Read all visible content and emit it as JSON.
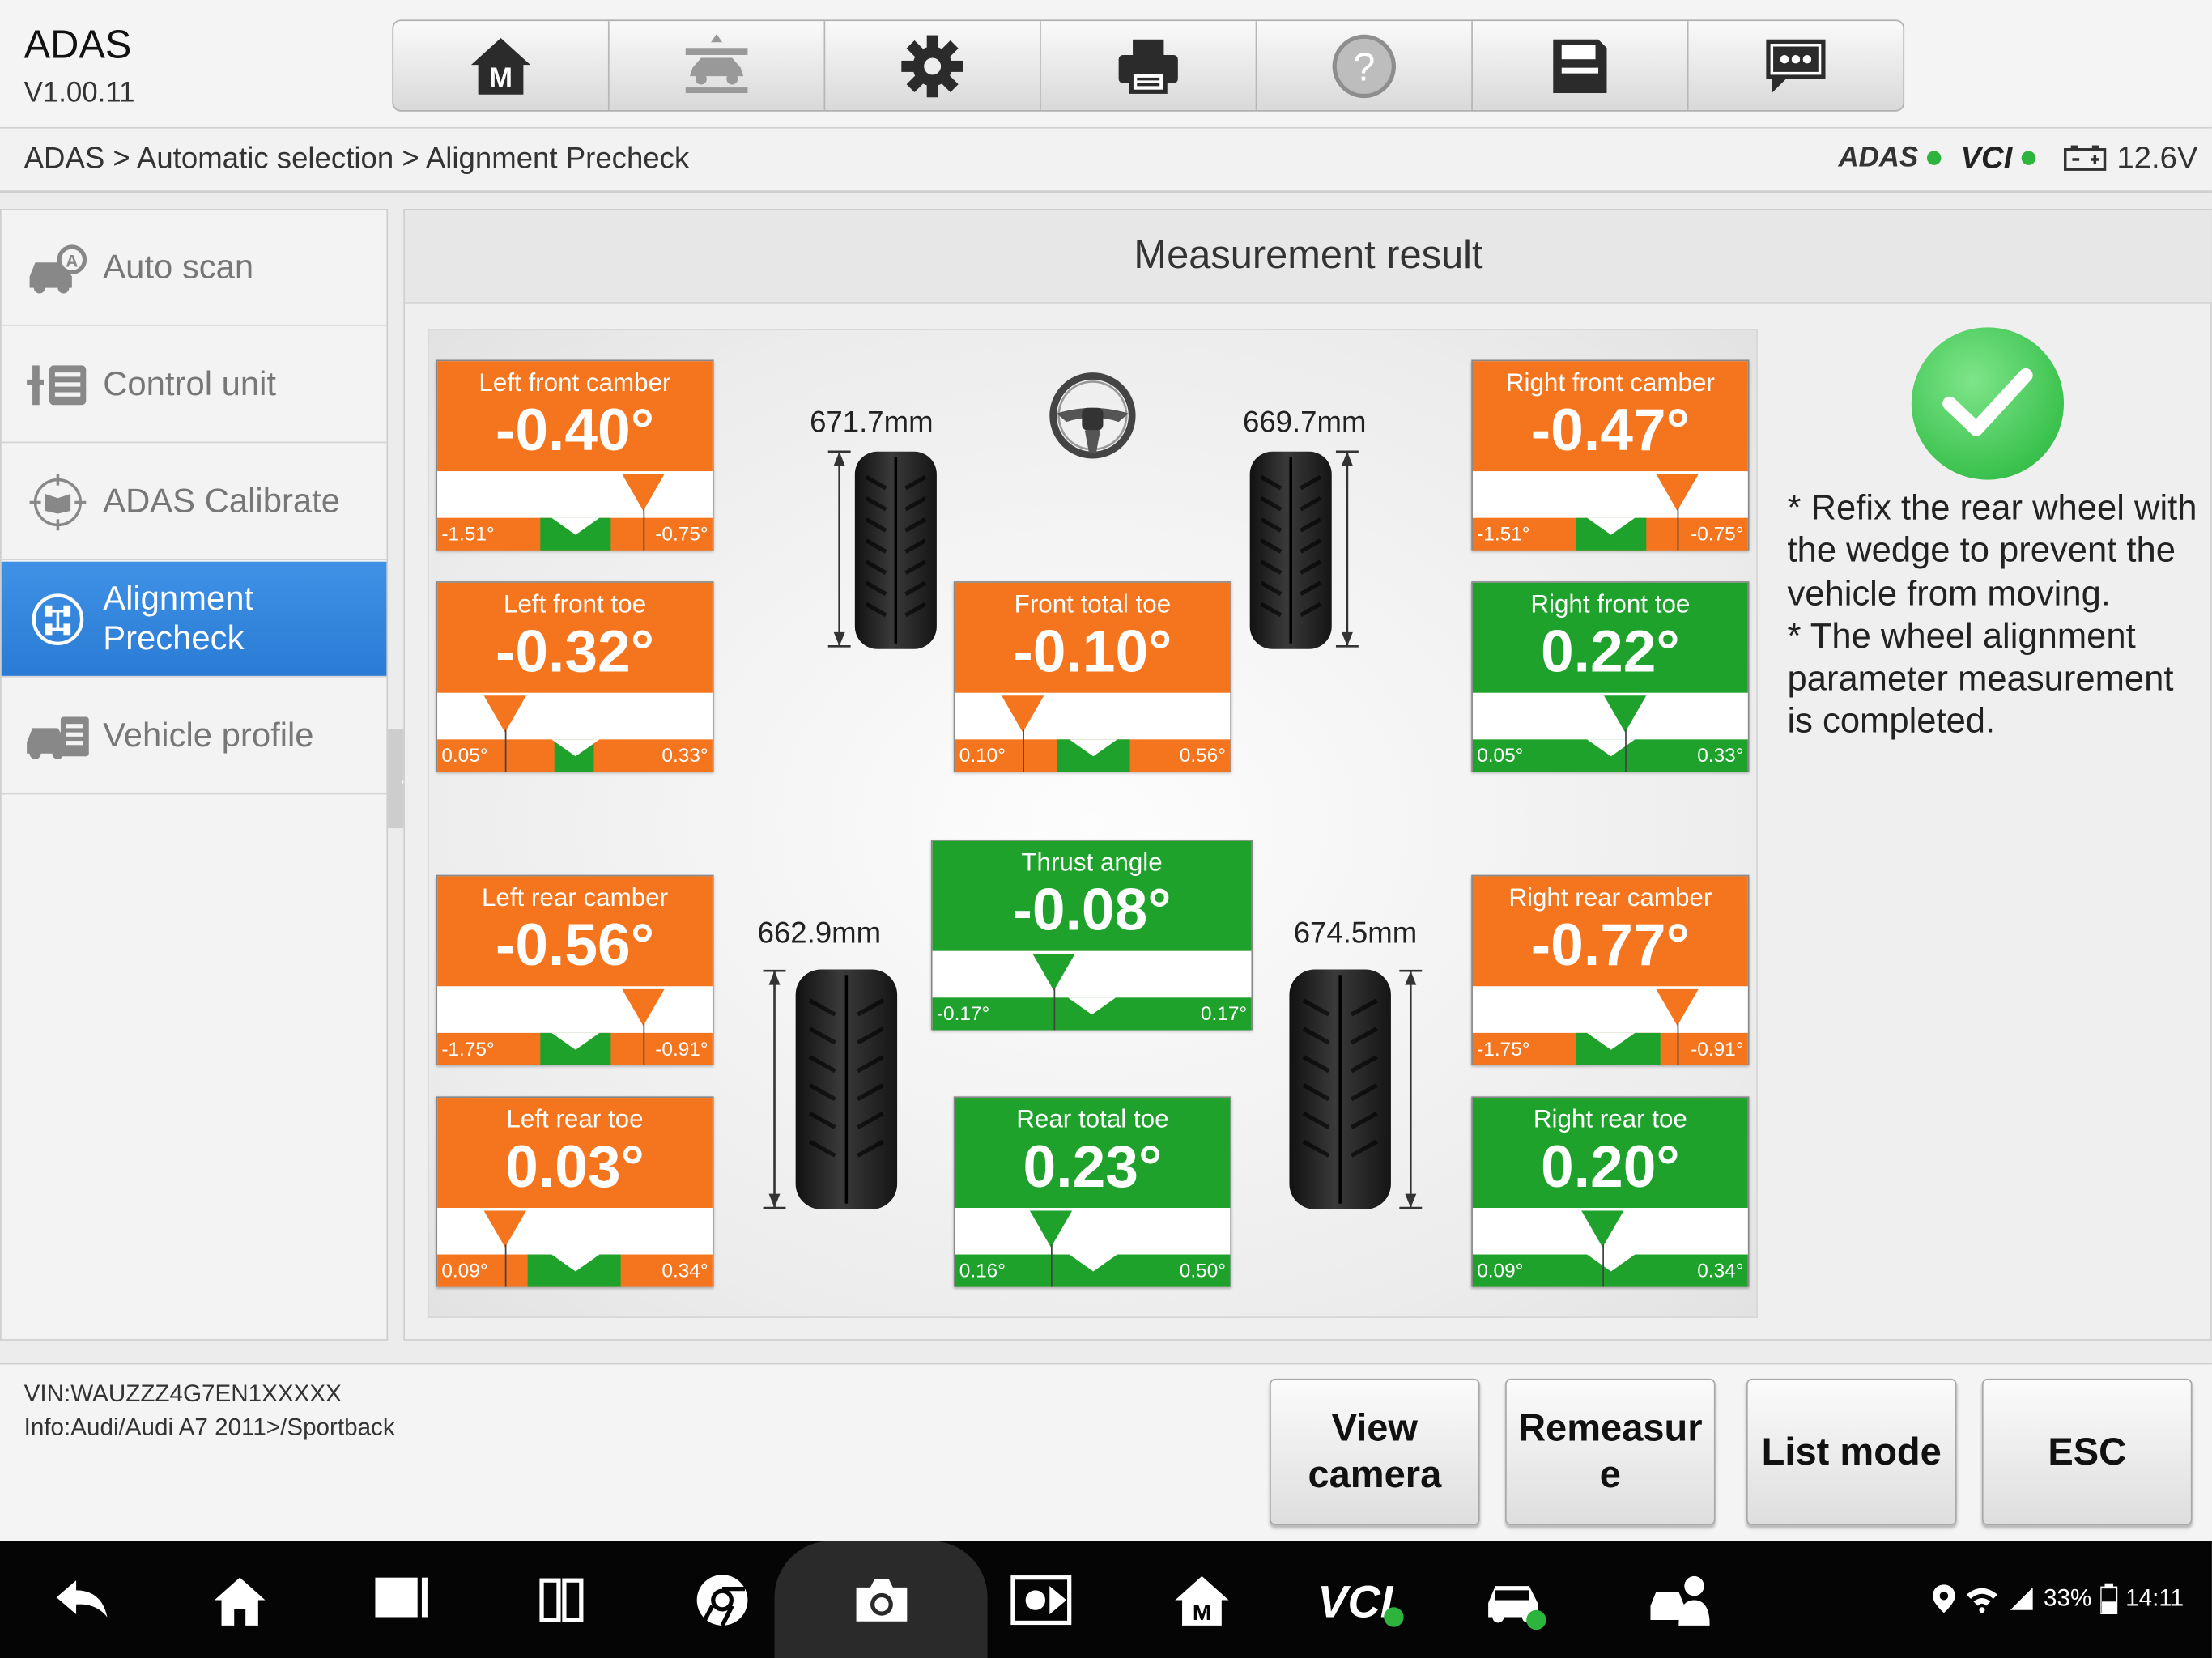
{
  "app": {
    "title": "ADAS",
    "version": "V1.00.11"
  },
  "toolbar": {
    "items": [
      "home-m-icon",
      "vehicle-lift-icon",
      "settings-gear-icon",
      "print-icon",
      "help-icon",
      "save-icon",
      "message-icon"
    ]
  },
  "breadcrumb": "ADAS > Automatic selection > Alignment Precheck",
  "status": {
    "adas_logo": "ADAS",
    "vci_logo": "VCI",
    "voltage": "12.6V",
    "connection_color": "#2db43c"
  },
  "sidebar": {
    "items": [
      {
        "label": "Auto scan",
        "icon": "car-scan-icon",
        "active": false
      },
      {
        "label": "Control unit",
        "icon": "tools-list-icon",
        "active": false
      },
      {
        "label": "ADAS Calibrate",
        "icon": "adas-target-icon",
        "active": false
      },
      {
        "label": "Alignment Precheck",
        "icon": "alignment-icon",
        "active": true
      },
      {
        "label": "Vehicle profile",
        "icon": "vehicle-profile-icon",
        "active": false
      }
    ]
  },
  "main": {
    "title": "Measurement result"
  },
  "measurements": {
    "left_front_camber": {
      "label": "Left front camber",
      "value": "-0.40°",
      "min": "-1.51°",
      "max": "-0.75°",
      "status": "out-of-range"
    },
    "right_front_camber": {
      "label": "Right front camber",
      "value": "-0.47°",
      "min": "-1.51°",
      "max": "-0.75°",
      "status": "out-of-range"
    },
    "left_front_toe": {
      "label": "Left front toe",
      "value": "-0.32°",
      "min": "0.05°",
      "max": "0.33°",
      "status": "out-of-range"
    },
    "front_total_toe": {
      "label": "Front total toe",
      "value": "-0.10°",
      "min": "0.10°",
      "max": "0.56°",
      "status": "out-of-range"
    },
    "right_front_toe": {
      "label": "Right front toe",
      "value": "0.22°",
      "min": "0.05°",
      "max": "0.33°",
      "status": "ok"
    },
    "thrust_angle": {
      "label": "Thrust angle",
      "value": "-0.08°",
      "min": "-0.17°",
      "max": "0.17°",
      "status": "ok"
    },
    "left_rear_camber": {
      "label": "Left rear camber",
      "value": "-0.56°",
      "min": "-1.75°",
      "max": "-0.91°",
      "status": "out-of-range"
    },
    "right_rear_camber": {
      "label": "Right rear camber",
      "value": "-0.77°",
      "min": "-1.75°",
      "max": "-0.91°",
      "status": "out-of-range"
    },
    "left_rear_toe": {
      "label": "Left rear toe",
      "value": "0.03°",
      "min": "0.09°",
      "max": "0.34°",
      "status": "out-of-range"
    },
    "rear_total_toe": {
      "label": "Rear total toe",
      "value": "0.23°",
      "min": "0.16°",
      "max": "0.50°",
      "status": "ok"
    },
    "right_rear_toe": {
      "label": "Right rear toe",
      "value": "0.20°",
      "min": "0.09°",
      "max": "0.34°",
      "status": "ok"
    }
  },
  "wheel_heights": {
    "left_front": "671.7mm",
    "right_front": "669.7mm",
    "left_rear": "662.9mm",
    "right_rear": "674.5mm"
  },
  "notes": "* Refix the rear wheel with the wedge to prevent the vehicle from moving.\n* The wheel alignment parameter measurement is completed.",
  "vehicle": {
    "vin": "VIN:WAUZZZ4G7EN1XXXXX",
    "info": "Info:Audi/Audi A7 2011>/Sportback"
  },
  "footer_buttons": {
    "view_camera": "View\ncamera",
    "remeasure": "Remeasur\ne",
    "list_mode": "List mode",
    "esc": "ESC"
  },
  "system_status": {
    "battery": "33%",
    "time": "14:11"
  },
  "colors": {
    "out_of_range": "#f5751f",
    "ok": "#1fa22c",
    "active_tab": "#2f82d8"
  }
}
